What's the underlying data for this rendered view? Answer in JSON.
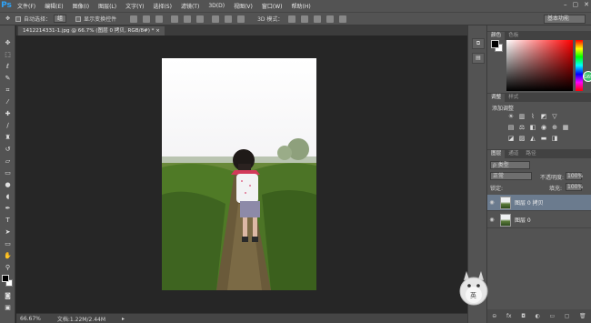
{
  "app": {
    "logo": "Ps"
  },
  "menu": [
    "文件(F)",
    "编辑(E)",
    "图像(I)",
    "图层(L)",
    "文字(Y)",
    "选择(S)",
    "滤镜(T)",
    "3D(D)",
    "视图(V)",
    "窗口(W)",
    "帮助(H)"
  ],
  "window_controls": [
    "–",
    "▢",
    "✕"
  ],
  "options": {
    "auto_select_label": "自动选择：",
    "auto_select_value": "组",
    "transform_label": "显示变换控件",
    "mode_3d_label": "3D 模式：",
    "workspace": "基本功能"
  },
  "document": {
    "tab_title": "1412214331-1.jpg @ 66.7% (图层 0 拷贝, RGB/8#) *",
    "zoom": "66.67%",
    "doc_info": "文档:1.22M/2.44M"
  },
  "color_panel": {
    "tabs": [
      "颜色",
      "色板"
    ],
    "badge": "G69",
    "fg": "#000000",
    "bg": "#ffffff"
  },
  "adjustments_panel": {
    "tabs": [
      "调整",
      "样式"
    ],
    "title": "添加调整"
  },
  "layers_panel": {
    "tabs": [
      "图层",
      "通道",
      "路径"
    ],
    "filter": "ρ 类型",
    "blend_mode": "正常",
    "opacity_label": "不透明度:",
    "opacity": "100%",
    "lock_label": "锁定:",
    "fill_label": "填充:",
    "fill": "100%",
    "layers": [
      {
        "name": "图层 0 拷贝",
        "selected": true
      },
      {
        "name": "图层 0",
        "selected": false
      }
    ]
  },
  "mascot": {
    "label": "英"
  },
  "colors": {
    "accent": "#2fa3f7",
    "panel": "#535353",
    "selected_layer": "#6b7b8e"
  }
}
